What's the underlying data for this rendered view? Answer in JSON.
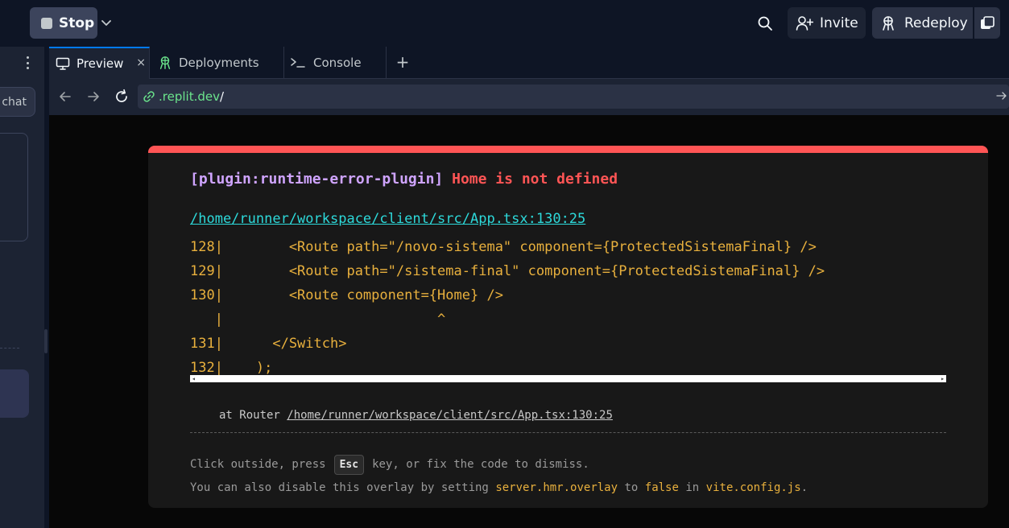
{
  "topbar": {
    "stop_label": "Stop",
    "invite_label": "Invite",
    "redeploy_label": "Redeploy"
  },
  "left_panel": {
    "chat_label": "chat"
  },
  "tabs": [
    {
      "label": "Preview",
      "close": "×"
    },
    {
      "label": "Deployments"
    },
    {
      "label": "Console"
    }
  ],
  "add_tab": "+",
  "url": {
    "host": ".replit.dev",
    "path": "/"
  },
  "error_overlay": {
    "plugin": "[plugin:runtime-error-plugin]",
    "message": "Home is not defined",
    "file": "/home/runner/workspace/client/src/App.tsx:130:25",
    "code_lines": [
      "128|        <Route path=\"/novo-sistema\" component={ProtectedSistemaFinal} />",
      "129|        <Route path=\"/sistema-final\" component={ProtectedSistemaFinal} />",
      "130|        <Route component={Home} />",
      "   |                          ^",
      "131|      </Switch>",
      "132|    );"
    ],
    "stack_prefix": "at Router",
    "stack_file": "/home/runner/workspace/client/src/App.tsx:130:25",
    "tip1_before": "Click outside, press",
    "tip1_key": "Esc",
    "tip1_after": "key, or fix the code to dismiss.",
    "tip2_a": "You can also disable this overlay by setting",
    "tip2_setting": "server.hmr.overlay",
    "tip2_b": "to",
    "tip2_value": "false",
    "tip2_c": "in",
    "tip2_file": "vite.config.js",
    "tip2_end": "."
  },
  "colors": {
    "accent_red": "#ff5555",
    "plugin_purple": "#cfa4ff",
    "code_orange": "#e8b03d",
    "file_cyan": "#2dd9da",
    "url_green": "#6be58c"
  }
}
